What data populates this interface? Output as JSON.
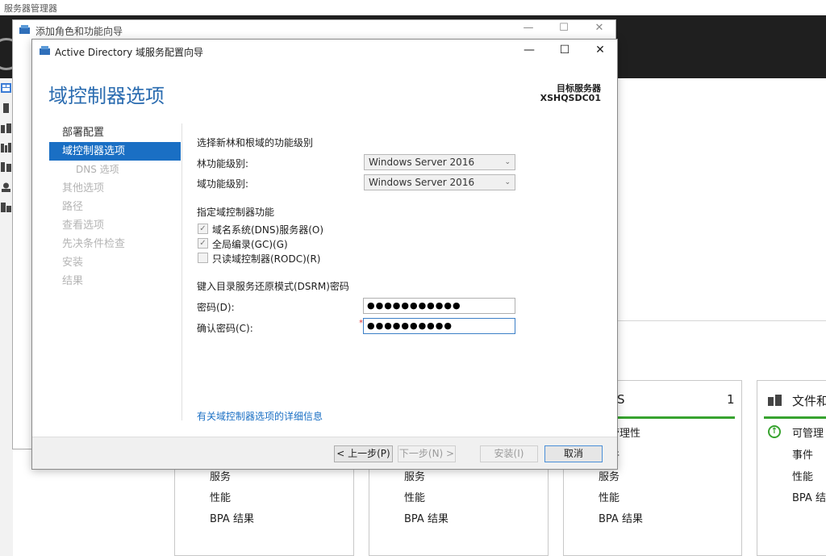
{
  "server_manager": {
    "title": "服务器管理器",
    "tiles": [
      {
        "title": "",
        "items": [
          "服务",
          "性能",
          "BPA 结果"
        ]
      },
      {
        "title": "",
        "items": [
          "服务",
          "性能",
          "BPA 结果"
        ]
      },
      {
        "title": "S",
        "count": "1",
        "items": [
          "可管理性",
          "事件",
          "服务",
          "性能",
          "BPA 结果"
        ]
      },
      {
        "title": "文件和",
        "items": [
          "可管理",
          "事件",
          "性能",
          "BPA 结"
        ]
      }
    ]
  },
  "add_roles_wizard": {
    "title": "添加角色和功能向导"
  },
  "wizard": {
    "title": "Active Directory 域服务配置向导",
    "heading": "域控制器选项",
    "target_server_label": "目标服务器",
    "target_server_name": "XSHQSDC01",
    "nav": [
      {
        "label": "部署配置",
        "state": "normal"
      },
      {
        "label": "域控制器选项",
        "state": "active"
      },
      {
        "label": "DNS 选项",
        "state": "sub"
      },
      {
        "label": "其他选项",
        "state": "disabled"
      },
      {
        "label": "路径",
        "state": "disabled"
      },
      {
        "label": "查看选项",
        "state": "disabled"
      },
      {
        "label": "先决条件检查",
        "state": "disabled"
      },
      {
        "label": "安装",
        "state": "disabled"
      },
      {
        "label": "结果",
        "state": "disabled"
      }
    ],
    "functional_level_heading": "选择新林和根域的功能级别",
    "forest_level_label": "林功能级别:",
    "forest_level_value": "Windows Server 2016",
    "domain_level_label": "域功能级别:",
    "domain_level_value": "Windows Server 2016",
    "dc_capabilities_heading": "指定域控制器功能",
    "dns_checkbox_label": "域名系统(DNS)服务器(O)",
    "dns_checked": true,
    "gc_checkbox_label": "全局编录(GC)(G)",
    "gc_checked": true,
    "rodc_checkbox_label": "只读域控制器(RODC)(R)",
    "rodc_checked": false,
    "dsrm_heading": "键入目录服务还原模式(DSRM)密码",
    "password_label": "密码(D):",
    "password_value": "●●●●●●●●●●●",
    "confirm_label": "确认密码(C):",
    "confirm_value": "●●●●●●●●●●",
    "required_mark": "*",
    "details_link": "有关域控制器选项的详细信息",
    "buttons": {
      "back": "< 上一步(P)",
      "next": "下一步(N) >",
      "install": "安装(I)",
      "cancel": "取消"
    },
    "caption": {
      "minimize": "—",
      "maximize": "☐",
      "close": "✕"
    }
  },
  "colors": {
    "accent": "#1a6fc4",
    "heading": "#2b6cb0",
    "status_green": "#37a32f",
    "header_dark": "#1f1f1f"
  }
}
